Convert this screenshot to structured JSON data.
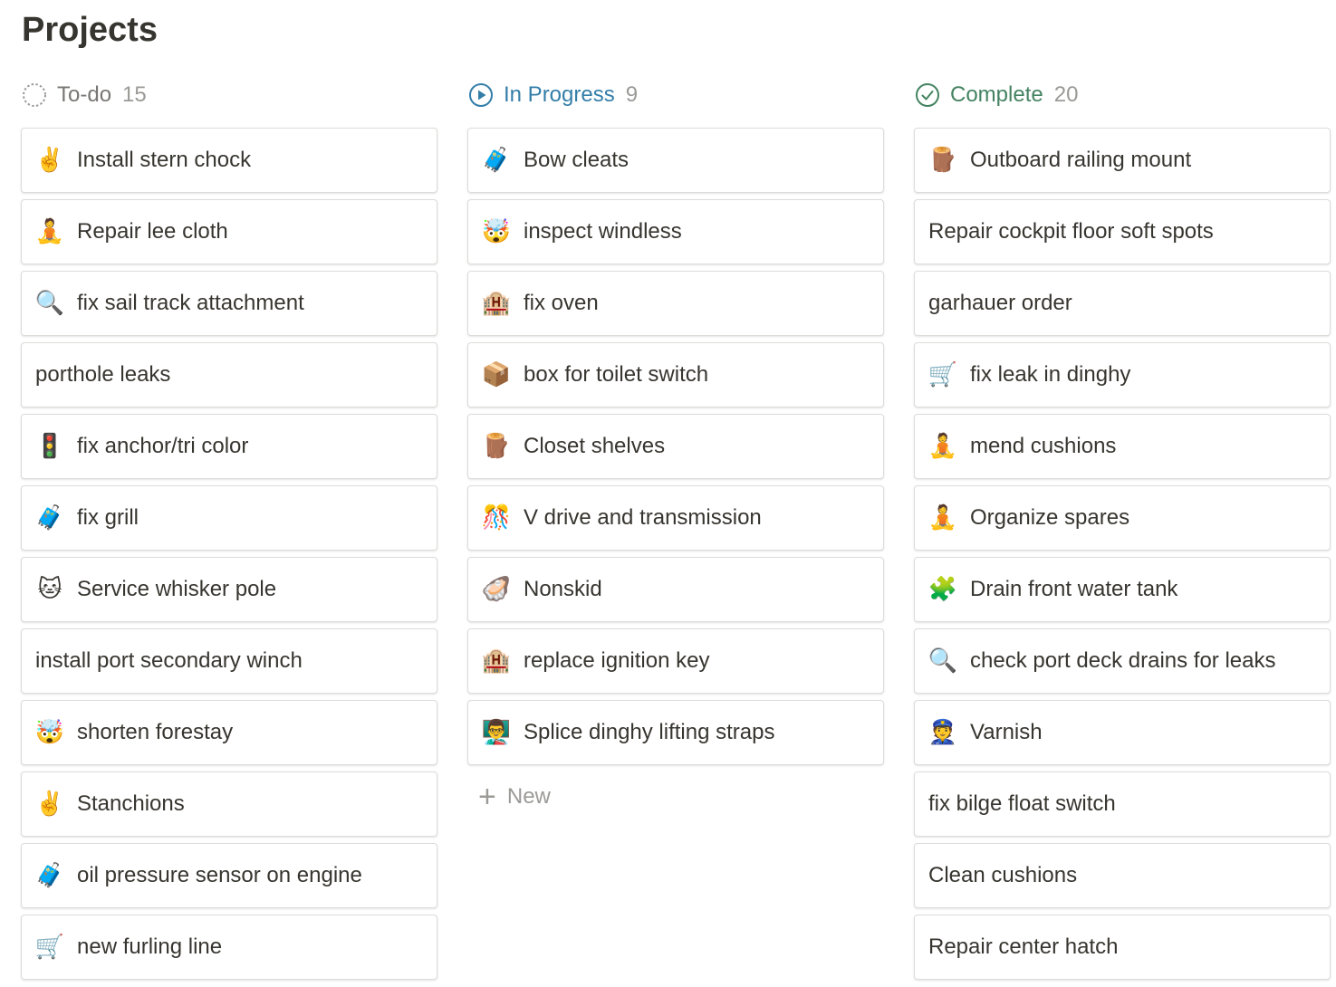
{
  "page": {
    "title": "Projects"
  },
  "columns": [
    {
      "title": "To-do",
      "count": "15",
      "status": "todo",
      "cards": [
        {
          "label": "Install stern chock",
          "emoji": "✌️"
        },
        {
          "label": "Repair lee cloth",
          "emoji": "🧘"
        },
        {
          "label": "fix sail track attachment",
          "emoji": "🔍"
        },
        {
          "label": "porthole leaks",
          "emoji": ""
        },
        {
          "label": "fix anchor/tri color",
          "emoji": "🚦"
        },
        {
          "label": "fix grill",
          "emoji": "🧳"
        },
        {
          "label": "Service whisker pole",
          "emoji": "🐱"
        },
        {
          "label": "install port secondary winch",
          "emoji": ""
        },
        {
          "label": "shorten forestay",
          "emoji": "🤯"
        },
        {
          "label": "Stanchions",
          "emoji": "✌️"
        },
        {
          "label": "oil pressure sensor on engine",
          "emoji": "🧳"
        },
        {
          "label": "new furling line",
          "emoji": "🛒"
        }
      ]
    },
    {
      "title": "In Progress",
      "count": "9",
      "status": "progress",
      "new_label": "New",
      "cards": [
        {
          "label": "Bow cleats",
          "emoji": "🧳"
        },
        {
          "label": "inspect windless",
          "emoji": "🤯"
        },
        {
          "label": "fix oven",
          "emoji": "🏨"
        },
        {
          "label": "box for toilet switch",
          "emoji": "📦"
        },
        {
          "label": "Closet shelves",
          "emoji": "🪵"
        },
        {
          "label": "V drive and transmission",
          "emoji": "🎊"
        },
        {
          "label": "Nonskid",
          "emoji": "🦪"
        },
        {
          "label": "replace ignition key",
          "emoji": "🏨"
        },
        {
          "label": "Splice dinghy lifting straps",
          "emoji": "👨‍🏫"
        }
      ]
    },
    {
      "title": "Complete",
      "count": "20",
      "status": "complete",
      "cards": [
        {
          "label": "Outboard railing mount",
          "emoji": "🪵"
        },
        {
          "label": "Repair cockpit floor soft spots",
          "emoji": ""
        },
        {
          "label": "garhauer order",
          "emoji": ""
        },
        {
          "label": "fix leak in dinghy",
          "emoji": "🛒"
        },
        {
          "label": "mend cushions",
          "emoji": "🧘"
        },
        {
          "label": "Organize spares",
          "emoji": "🧘"
        },
        {
          "label": "Drain front water tank",
          "emoji": "🧩"
        },
        {
          "label": "check port deck drains for leaks",
          "emoji": "🔍"
        },
        {
          "label": "Varnish",
          "emoji": "👮"
        },
        {
          "label": "fix bilge float switch",
          "emoji": ""
        },
        {
          "label": "Clean cushions",
          "emoji": ""
        },
        {
          "label": "Repair center hatch",
          "emoji": ""
        }
      ]
    }
  ],
  "colors": {
    "todo": "#787774",
    "progress": "#337ea9",
    "complete": "#448361",
    "count": "#9b9a97"
  }
}
